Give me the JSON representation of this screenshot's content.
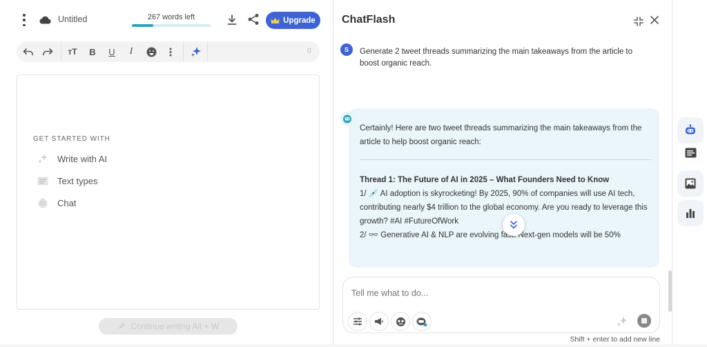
{
  "header": {
    "doc_title": "Untitled",
    "words_left": "267 words left",
    "progress": 0.27,
    "upgrade_label": "Upgrade"
  },
  "toolbar": {
    "count": "0",
    "items": [
      "undo-icon",
      "redo-icon",
      "text-size-icon",
      "bold-icon",
      "underline-icon",
      "italic-icon",
      "emoji-icon",
      "more-icon",
      "ai-sparkle-icon"
    ]
  },
  "editor": {
    "get_started_label": "GET STARTED WITH",
    "items": [
      {
        "label": "Write with AI",
        "icon": "sparkle-icon"
      },
      {
        "label": "Text types",
        "icon": "text-types-icon"
      },
      {
        "label": "Chat",
        "icon": "chat-bot-icon"
      }
    ],
    "continue_label": "Continue writing Alt + W"
  },
  "chat": {
    "title": "ChatFlash",
    "user_avatar": "S",
    "user_message": "Generate 2 tweet threads summarizing the main takeaways from the article to boost organic reach.",
    "bot_intro": "Certainly! Here are two tweet threads summarizing the main takeaways from the article to help boost organic reach:",
    "thread_heading": "Thread 1: The Future of AI in 2025 – What Founders Need to Know",
    "para1": "1/ 💉 AI adoption is skyrocketing! By 2025, 90% of companies will use AI tech, contributing nearly $4 trillion to the global economy. Are you ready to leverage this growth? #AI #FutureOfWork",
    "para2": "2/ 👓 Generative AI & NLP are evolving fast. Next-gen models will be 50%",
    "input_placeholder": "Tell me what to do...",
    "hint": "Shift + enter to add new line"
  },
  "colors": {
    "accent": "#3d63d6",
    "teal": "#2aa6b8",
    "bubble": "#eaf6fa"
  }
}
